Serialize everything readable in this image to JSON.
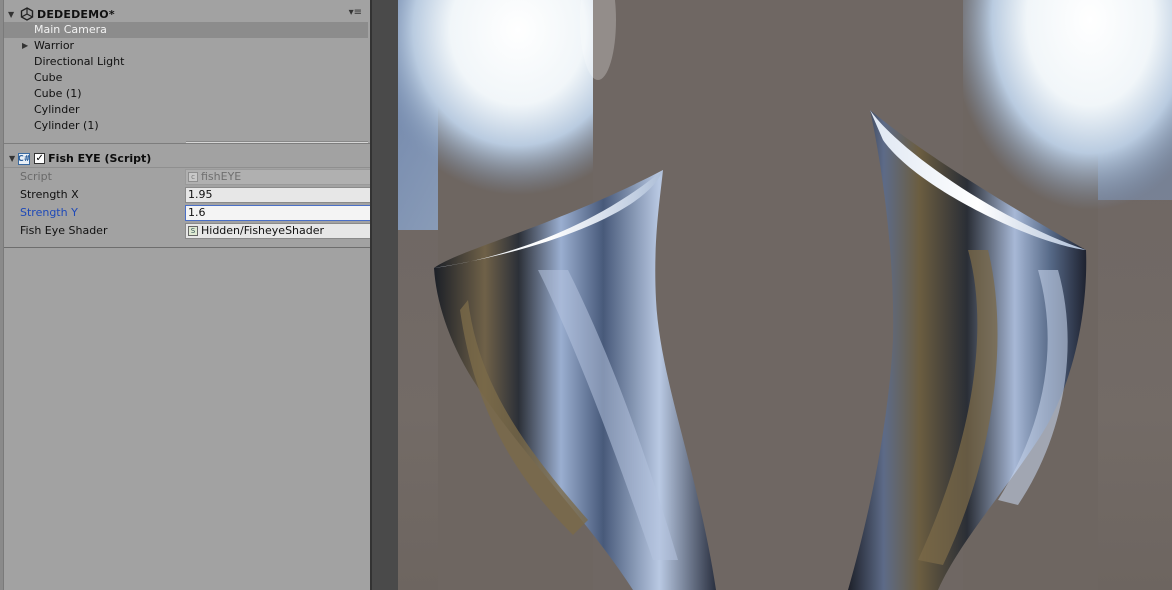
{
  "hierarchy": {
    "scene_name": "DEDEDEMO*",
    "items": [
      {
        "label": "Main Camera",
        "selected": true,
        "has_children": false
      },
      {
        "label": "Warrior",
        "selected": false,
        "has_children": true
      },
      {
        "label": "Directional Light",
        "selected": false,
        "has_children": false
      },
      {
        "label": "Cube",
        "selected": false,
        "has_children": false
      },
      {
        "label": "Cube (1)",
        "selected": false,
        "has_children": false
      },
      {
        "label": "Cylinder",
        "selected": false,
        "has_children": false
      },
      {
        "label": "Cylinder (1)",
        "selected": false,
        "has_children": false
      }
    ]
  },
  "inspector": {
    "component": {
      "title": "Fish EYE (Script)",
      "enabled": true,
      "icon": "csharp-script-icon"
    },
    "properties": {
      "script": {
        "label": "Script",
        "value": "fishEYE"
      },
      "strength_x": {
        "label": "Strength X",
        "value": "1.95"
      },
      "strength_y": {
        "label": "Strength Y",
        "value": "1.6"
      },
      "fish_eye_shader": {
        "label": "Fish Eye Shader",
        "value": "Hidden/FisheyeShader"
      }
    }
  },
  "icons": {
    "scene_icon": "unity-logo-icon",
    "menu_icon": "panel-menu-icon",
    "foldout_icon": "triangle-right-icon"
  },
  "colors": {
    "panel_bg": "#a2a2a2",
    "selection_bg": "#8c8c8c",
    "active_label": "#1e49b8",
    "scene_bg": "#6f6764"
  }
}
